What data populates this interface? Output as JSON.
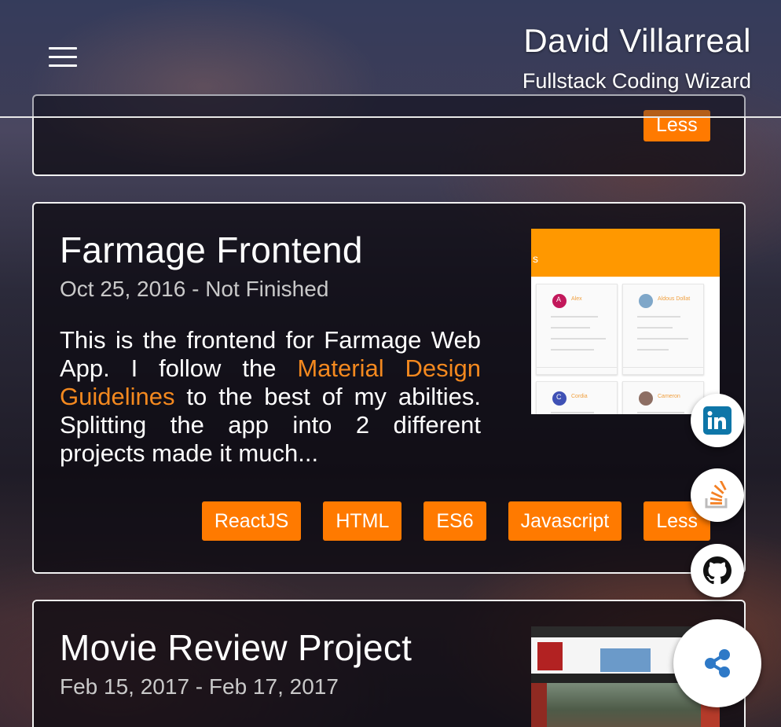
{
  "header": {
    "name": "David Villarreal",
    "tagline": "Fullstack Coding Wizard"
  },
  "previous_card": {
    "tag": "Less"
  },
  "projects": [
    {
      "title": "Farmage Frontend",
      "date": "Oct 25, 2016 - Not Finished",
      "description_before": "This is the frontend for Farmage Web App. I follow the ",
      "description_link": "Material Design Guidelines",
      "description_after": "  to the best of my abilties. Splitting the app into 2 different projects made it much...",
      "thumbnail": {
        "header_letter": "s",
        "contacts": [
          {
            "initial": "A",
            "name": "Alex"
          },
          {
            "initial": "",
            "name": "Aldous Dollat"
          },
          {
            "initial": "C",
            "name": "Cordia"
          },
          {
            "initial": "",
            "name": "Cameron"
          }
        ]
      },
      "tags": [
        "ReactJS",
        "HTML",
        "ES6",
        "Javascript",
        "Less"
      ]
    },
    {
      "title": "Movie Review Project",
      "date": "Feb 15, 2017 - Feb 17, 2017"
    }
  ],
  "social": {
    "linkedin_label": "in",
    "icons": [
      "linkedin-icon",
      "stackoverflow-icon",
      "github-icon",
      "share-icon"
    ]
  },
  "colors": {
    "accent": "#ff7a00",
    "link": "#f4891f",
    "linkedin": "#0e76a8",
    "stackoverflow": "#f48024",
    "share": "#2e79c7"
  }
}
